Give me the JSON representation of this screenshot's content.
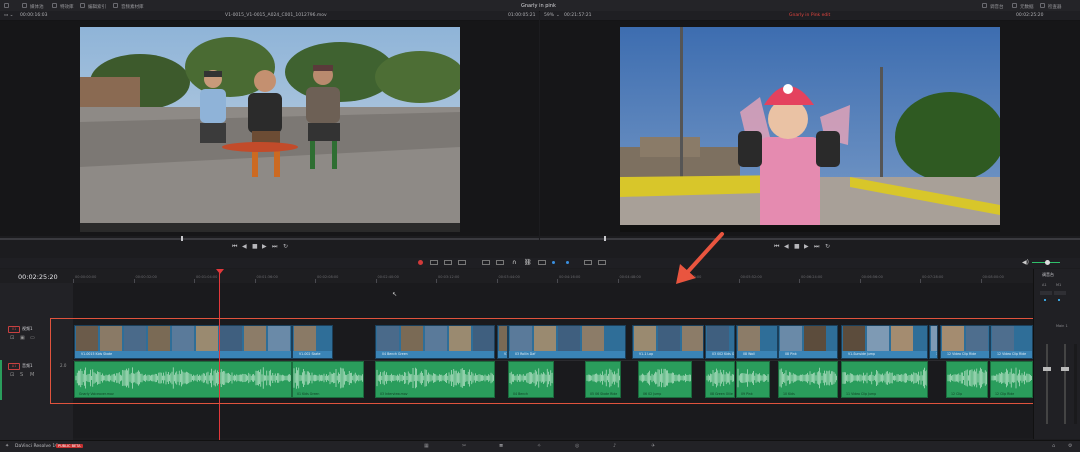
{
  "topbar": {
    "items": [
      "媒体池",
      "特效库",
      "编辑索引",
      "音频素材库"
    ],
    "project_title": "Gnarly in pink",
    "right_items": [
      "调音台",
      "元数据",
      "检查器"
    ]
  },
  "source_viewer": {
    "timecode_in": "00:00:16:03",
    "clip_name": "V1-0015_V1-0015_A024_C001_1012796.mov",
    "timecode_out": "01:00:05:21"
  },
  "timeline_viewer": {
    "zoom": "59%",
    "timecode_in": "00:21:57:21",
    "timeline_name": "Gnarly in Pink edit",
    "timecode_out": "00:02:25:20"
  },
  "timeline": {
    "current_timecode": "00:02:25:20",
    "ruler_ticks": [
      "00:00:00:00",
      "00:00:32:00",
      "00:01:04:00",
      "00:01:36:00",
      "00:02:08:00",
      "00:02:40:00",
      "00:03:12:00",
      "00:03:44:00",
      "00:04:16:00",
      "00:04:48:00",
      "00:05:20:00",
      "00:05:52:00",
      "00:06:24:00",
      "00:06:56:00",
      "00:07:28:00",
      "00:08:00:00"
    ],
    "video_track_name": "视频1",
    "audio_track_name": "音频1",
    "audio_level": "2.0",
    "video_clips": [
      "V1-0015 Kids Skate",
      "V1-002 Skate",
      "04 Bench Green",
      "V1-B-Sunrise",
      "03 Rollin Daf",
      "V1-1 Lop",
      "03 002 Kids Green Ollie",
      "08 Wall",
      "08 Pink",
      "V1-Sunside Jump",
      "11 Video Clip Jump",
      "12 Video Clip Ride",
      "12 Video Clip Ride"
    ],
    "audio_clips": [
      "Gnarly Voiceover.mov",
      "01 Kids Green",
      "03 Interview.mov",
      "04 Bench",
      "05 06 Skate Ride",
      "06 02 Jump",
      "08 Green Ollie",
      "09 Pink",
      "10 Kids",
      "11 Video Clip Jump",
      "12 Clip",
      "12 Clip Ride"
    ]
  },
  "mixer": {
    "title": "调音台",
    "channels": [
      "A1",
      "M1",
      "Main 1"
    ]
  },
  "bottombar": {
    "app_name": "DaVinci Resolve 16",
    "badge": "PUBLIC BETA"
  },
  "colors": {
    "video_clip": "#2f6e98",
    "audio_clip": "#2a9d5c",
    "playhead": "#e2383b",
    "annotation": "#e0533d"
  }
}
